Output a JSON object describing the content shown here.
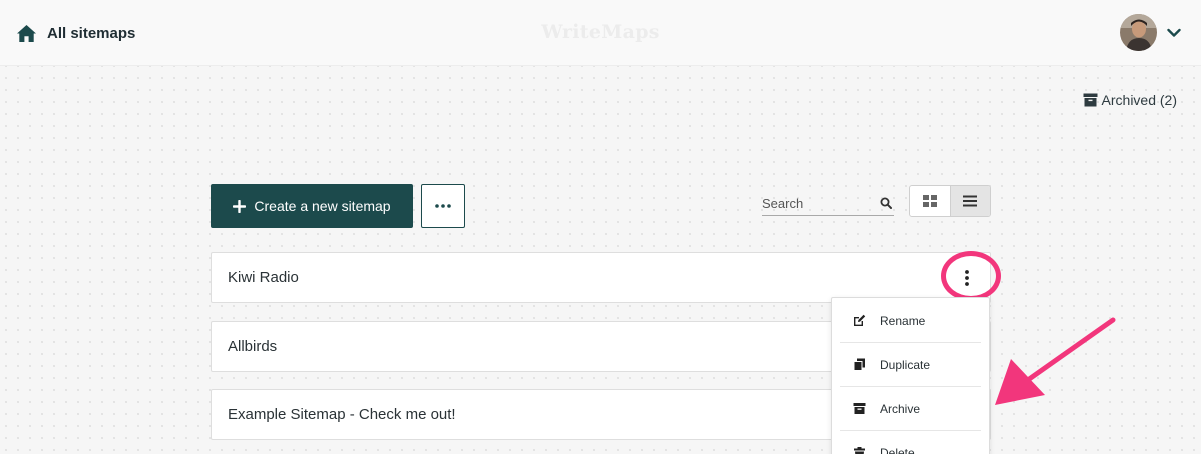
{
  "header": {
    "home_label": "All sitemaps",
    "brand": "WriteMaps"
  },
  "archived": {
    "label": "Archived (2)"
  },
  "toolbar": {
    "create_label": "Create a new sitemap",
    "search_placeholder": "Search"
  },
  "sitemaps": [
    {
      "title": "Kiwi Radio"
    },
    {
      "title": "Allbirds"
    },
    {
      "title": "Example Sitemap - Check me out!"
    }
  ],
  "context_menu": {
    "items": [
      {
        "label": "Rename",
        "icon": "edit-icon"
      },
      {
        "label": "Duplicate",
        "icon": "copy-icon"
      },
      {
        "label": "Archive",
        "icon": "archive-icon"
      },
      {
        "label": "Delete",
        "icon": "trash-icon"
      }
    ]
  },
  "colors": {
    "primary": "#1c4a4c",
    "annotation": "#f2367c",
    "background": "#f6f6f6"
  }
}
